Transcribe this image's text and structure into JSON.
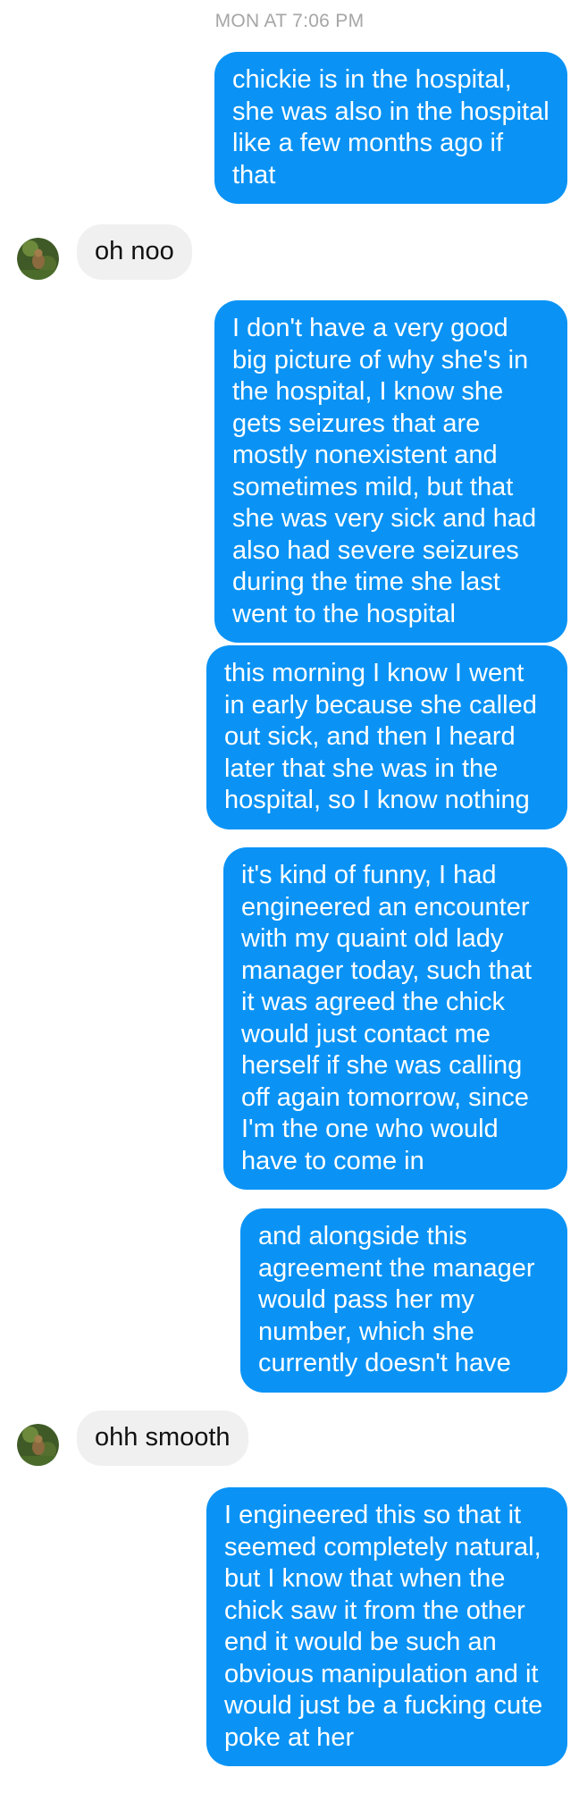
{
  "conversation": {
    "timestamp": "MON AT 7:06 PM",
    "messages": [
      {
        "side": "sent",
        "text": "chickie is in the hospital, she was also in the hospital like a few months ago if that"
      },
      {
        "side": "received",
        "text": "oh noo"
      },
      {
        "side": "sent",
        "text": "I don't have a very good big picture of why she's in the hospital, I know she gets seizures that are mostly nonexistent and sometimes mild, but that she was very sick and had also had severe seizures during the time she last went to the hospital"
      },
      {
        "side": "sent",
        "text": "this morning I know I went in early because she called out sick, and then I heard later that she was in the hospital, so I know nothing"
      },
      {
        "side": "sent",
        "text": "it's kind of funny, I had engineered an encounter with my quaint old lady manager today, such that it was agreed the chick would just contact me herself if she was calling off again tomorrow, since I'm the one who would have to come in"
      },
      {
        "side": "sent",
        "text": "and alongside this agreement the manager would pass her my number, which she currently doesn't have"
      },
      {
        "side": "received",
        "text": "ohh smooth"
      },
      {
        "side": "sent",
        "text": "I engineered this so that it seemed completely natural, but I know that when the chick saw it from the other end it would be such an obvious manipulation and it would just be a fucking cute poke at her"
      }
    ]
  },
  "colors": {
    "sent_bubble": "#0a93f5",
    "received_bubble": "#f0f0f0",
    "timestamp_text": "#a6a6a6"
  },
  "icons": {
    "contact_avatar": "avatar-photo"
  }
}
